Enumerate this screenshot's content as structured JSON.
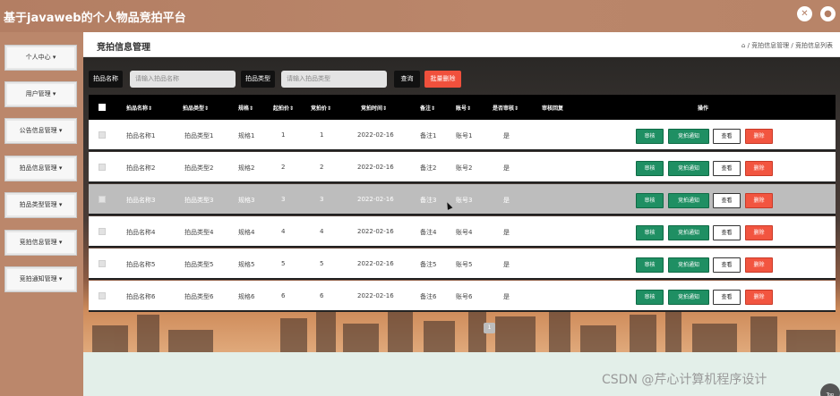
{
  "app": {
    "title": "基于javaweb的个人物品竞拍平台"
  },
  "topbar": {
    "fullscreen_icon": "✕",
    "user_icon": "●"
  },
  "sidebar": {
    "items": [
      {
        "label": "个人中心"
      },
      {
        "label": "用户管理"
      },
      {
        "label": "公告信息管理"
      },
      {
        "label": "拍品信息管理"
      },
      {
        "label": "拍品类型管理"
      },
      {
        "label": "竞拍信息管理"
      },
      {
        "label": "竞拍通知管理"
      }
    ],
    "chevron": "▾"
  },
  "page": {
    "title": "竞拍信息管理",
    "breadcrumb": {
      "home_icon": "⌂",
      "parts": [
        "竞拍信息管理",
        "竞拍信息列表"
      ],
      "sep": "/"
    }
  },
  "search": {
    "name_label": "拍品名称",
    "name_placeholder": "请输入拍品名称",
    "type_label": "拍品类型",
    "type_placeholder": "请输入拍品类型",
    "query_button": "查询",
    "batch_delete_button": "批量删除"
  },
  "table": {
    "headers": [
      "拍品名称",
      "拍品类型",
      "规格",
      "起拍价",
      "竞拍价",
      "竞拍时间",
      "备注",
      "账号",
      "是否审核",
      "审核回复",
      "操作"
    ],
    "sort_icon": "⇕",
    "rows": [
      {
        "name": "拍品名称1",
        "type": "拍品类型1",
        "spec": "规格1",
        "start": "1",
        "bid": "1",
        "time": "2022-02-16",
        "note": "备注1",
        "account": "账号1",
        "audited": "是",
        "reply": ""
      },
      {
        "name": "拍品名称2",
        "type": "拍品类型2",
        "spec": "规格2",
        "start": "2",
        "bid": "2",
        "time": "2022-02-16",
        "note": "备注2",
        "account": "账号2",
        "audited": "是",
        "reply": ""
      },
      {
        "name": "拍品名称3",
        "type": "拍品类型3",
        "spec": "规格3",
        "start": "3",
        "bid": "3",
        "time": "2022-02-16",
        "note": "备注3",
        "account": "账号3",
        "audited": "是",
        "reply": ""
      },
      {
        "name": "拍品名称4",
        "type": "拍品类型4",
        "spec": "规格4",
        "start": "4",
        "bid": "4",
        "time": "2022-02-16",
        "note": "备注4",
        "account": "账号4",
        "audited": "是",
        "reply": ""
      },
      {
        "name": "拍品名称5",
        "type": "拍品类型5",
        "spec": "规格5",
        "start": "5",
        "bid": "5",
        "time": "2022-02-16",
        "note": "备注5",
        "account": "账号5",
        "audited": "是",
        "reply": ""
      },
      {
        "name": "拍品名称6",
        "type": "拍品类型6",
        "spec": "规格6",
        "start": "6",
        "bid": "6",
        "time": "2022-02-16",
        "note": "备注6",
        "account": "账号6",
        "audited": "是",
        "reply": ""
      }
    ],
    "highlighted_row": 2,
    "actions": {
      "audit": "审核",
      "notify": "竞拍通知",
      "view": "查看",
      "delete": "删除"
    }
  },
  "pagination": {
    "current": "1"
  },
  "watermark": "CSDN @芹心计算机程序设计",
  "back_to_top": "Top",
  "colors": {
    "accent_brown": "#b37e63",
    "action_green": "#1f8f63",
    "action_red": "#f25540"
  }
}
